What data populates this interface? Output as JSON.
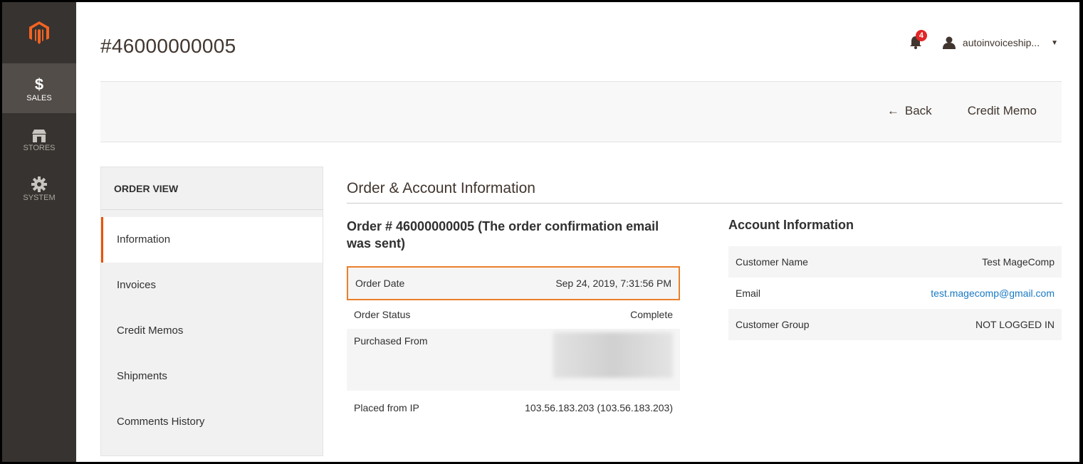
{
  "header": {
    "title": "#46000000005",
    "notifications_count": "4",
    "user_name": "autoinvoiceship..."
  },
  "sidebar": {
    "items": [
      {
        "label": "SALES",
        "icon": "dollar-icon"
      },
      {
        "label": "STORES",
        "icon": "store-icon"
      },
      {
        "label": "SYSTEM",
        "icon": "gear-icon"
      }
    ]
  },
  "actions": {
    "back_label": "Back",
    "credit_memo_label": "Credit Memo"
  },
  "tabs": {
    "title": "ORDER VIEW",
    "items": [
      "Information",
      "Invoices",
      "Credit Memos",
      "Shipments",
      "Comments History"
    ]
  },
  "main": {
    "section_title": "Order & Account Information",
    "order_title": "Order # 46000000005 (The order confirmation email was sent)",
    "order_date_label": "Order Date",
    "order_date_value": "Sep 24, 2019, 7:31:56 PM",
    "order_status_label": "Order Status",
    "order_status_value": "Complete",
    "purchased_from_label": "Purchased From",
    "placed_ip_label": "Placed from IP",
    "placed_ip_value": "103.56.183.203 (103.56.183.203)"
  },
  "account": {
    "title": "Account Information",
    "customer_name_label": "Customer Name",
    "customer_name_value": "Test MageComp",
    "email_label": "Email",
    "email_value": "test.magecomp@gmail.com",
    "group_label": "Customer Group",
    "group_value": "NOT LOGGED IN"
  },
  "colors": {
    "accent": "#eb5202",
    "highlight_border": "#eb7f2a",
    "sidebar_bg": "#373330",
    "link": "#1979c3"
  }
}
